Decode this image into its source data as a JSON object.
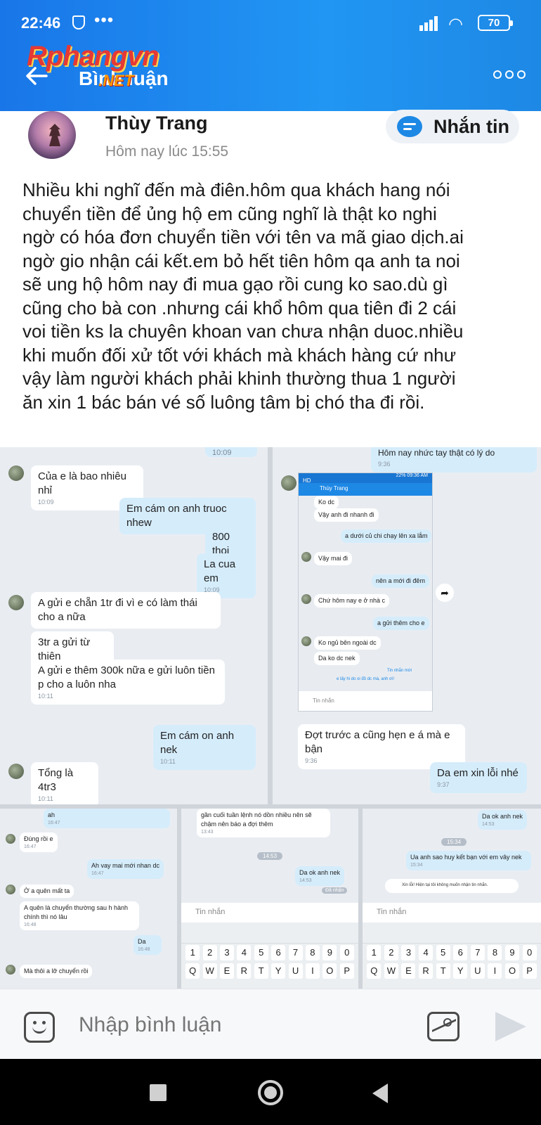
{
  "status": {
    "time": "22:46",
    "dots": "•••",
    "battery": "70"
  },
  "header": {
    "title": "Bình luận",
    "watermark": "Rphangvn",
    "watermark_suffix": ".NET"
  },
  "post": {
    "author": "Thùy Trang",
    "timestamp": "Hôm nay lúc 15:55",
    "message_button": "Nhắn tin",
    "body_lines": [
      "Nhiều khi nghĩ đến mà điên.hôm qua khách hang nói",
      "chuyển tiền để ủng hộ em cũng nghĩ là thật ko nghi",
      "ngờ có hóa đơn chuyển tiền với tên va mã giao dịch.ai",
      "ngờ gio nhận cái kết.em bỏ hết tiên hôm qa anh ta noi",
      "sẽ ung hộ hôm nay đi mua gạo rồi cung ko sao.dù gì",
      "cũng cho bà con .nhưng cái khổ hôm qua tiên đi 2 cái",
      "voi tiền ks la chuyên khoan van chưa nhận duoc.nhiều",
      "khi muốn đối xử tốt với khách mà khách hàng cứ như",
      "vậy làm người khách phải khinh thường thua 1 người",
      "ăn xin 1 bác bán vé số luông tâm bị chó tha đi rồi."
    ]
  },
  "screenshots": {
    "left": {
      "top_time": "10:09",
      "messages": [
        {
          "dir": "in",
          "text": "Của e là bao nhiêu nhỉ",
          "time": "10:09"
        },
        {
          "dir": "out",
          "text": "Em cám on anh truoc nhew",
          "time": ""
        },
        {
          "dir": "out",
          "text": "800 thoi",
          "time": ""
        },
        {
          "dir": "out",
          "text": "La cua em",
          "time": "10:09"
        },
        {
          "dir": "in",
          "text": "A gửi e chẵn 1tr đi vì e có làm thái cho a nữa",
          "time": ""
        },
        {
          "dir": "in",
          "text": "3tr a gửi từ thiện",
          "time": ""
        },
        {
          "dir": "in",
          "text": "A gửi e thêm 300k nữa e gửi luôn tiền p cho a luôn nha",
          "time": "10:11"
        },
        {
          "dir": "out",
          "text": "Em cám on anh nek",
          "time": "10:11"
        },
        {
          "dir": "in",
          "text": "Tổng là 4tr3",
          "time": "10:11"
        }
      ]
    },
    "right": {
      "top_text": "Hôm nay nhức tay thật có lý do",
      "top_time": "9:36",
      "inner_title": "Thùy Trang",
      "inner_badge": "HD",
      "inner_status": "22% 09:36 AM",
      "inner_messages": [
        "Ko dc",
        "Vậy anh đi nhanh đi",
        "a dưới củ chi chạy lên xa lắm",
        "Vậy mai đi",
        "nên a mới đi đêm",
        "Chứ hôm nay e ở nhà c",
        "a gửi thêm cho e",
        "Ko ngủ bên ngoài dc",
        "Da ko dc nek",
        "Tin nhắn mới",
        "e lấy hi do oi đồ dc mà, anh ơi!"
      ],
      "inner_input": "Tin nhắn",
      "messages": [
        {
          "dir": "in",
          "text": "Đợt trước a cũng hẹn e á mà e bận",
          "time": "9:36"
        },
        {
          "dir": "out",
          "text": "Da em xin lỗi nhé",
          "time": "9:37"
        }
      ]
    },
    "bottom_left": {
      "messages": [
        {
          "dir": "out",
          "text": "ah",
          "time": "16:47"
        },
        {
          "dir": "in",
          "text": "Đúng rồi e",
          "time": "16:47"
        },
        {
          "dir": "out",
          "text": "Ah vay mai mới nhan dc",
          "time": "16:47"
        },
        {
          "dir": "in",
          "text": "Ờ a quên mất ta",
          "time": ""
        },
        {
          "dir": "in",
          "text": "A quên là chuyển thường sau h hành chính thì nó lâu",
          "time": "16:48"
        },
        {
          "dir": "out",
          "text": "Da",
          "time": "16:48"
        },
        {
          "dir": "in",
          "text": "Mà thôi a lỡ chuyển rồi",
          "time": ""
        }
      ]
    },
    "bottom_mid": {
      "messages": [
        {
          "dir": "in",
          "text": "gần cuối tuần lệnh nó dồn nhiều nên sẽ chậm nên báo a đợi thêm",
          "time": "13:43"
        },
        {
          "dir": "out",
          "text": "Da ok anh nek",
          "time": "14:53"
        }
      ],
      "chip": "14:53",
      "seen": "Đã nhận",
      "input": "Tin nhắn"
    },
    "bottom_right": {
      "messages": [
        {
          "dir": "out",
          "text": "Da ok anh nek",
          "time": "14:53"
        },
        {
          "dir": "out",
          "text": "Ua anh sao huy kết bạn với em vây nek",
          "time": "15:34"
        }
      ],
      "chip": "15:34",
      "notice": "Xin lỗi! Hiện tại tôi không muốn nhận tin nhắn.",
      "input": "Tin nhắn"
    },
    "keyboard": {
      "row1": [
        "1",
        "2",
        "3",
        "4",
        "5",
        "6",
        "7",
        "8",
        "9",
        "0"
      ],
      "row2": [
        "Q",
        "W",
        "E",
        "R",
        "T",
        "Y",
        "U",
        "I",
        "O",
        "P"
      ]
    }
  },
  "comment": {
    "placeholder": "Nhập bình luận"
  }
}
